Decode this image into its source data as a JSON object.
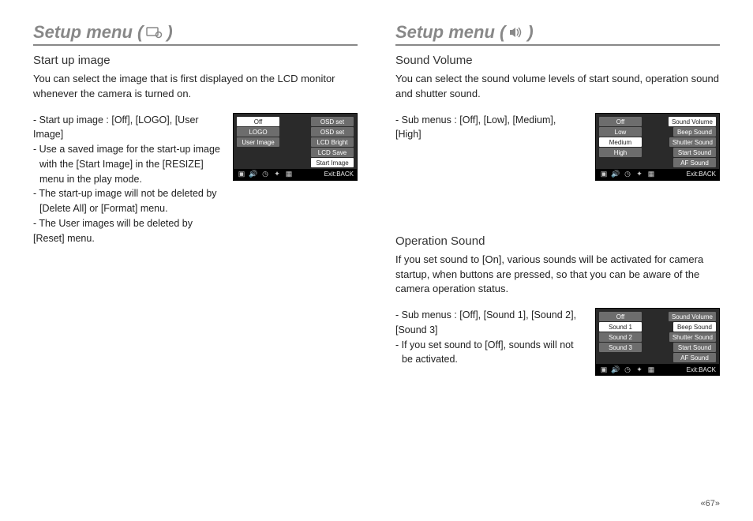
{
  "page_number": "«67»",
  "left": {
    "title_pre": "Setup menu (",
    "title_post": ")",
    "sections": [
      {
        "heading": "Start up image",
        "desc": "You can select the image that is first displayed on the LCD monitor whenever the camera is turned on.",
        "bullets": [
          "- Start up image : [Off], [LOGO], [User Image]",
          "- Use a saved image for the start-up image with the [Start Image] in the [RESIZE] menu in the play mode.",
          "- The start-up image will not be deleted by [Delete All] or [Format] menu.",
          "- The User images will be deleted by [Reset] menu."
        ],
        "lcd": {
          "left_items": [
            "Off",
            "LOGO",
            "User Image",
            "",
            ""
          ],
          "left_selected": 0,
          "right_items": [
            "OSD set",
            "OSD set",
            "LCD Bright",
            "LCD Save",
            "Start Image"
          ],
          "right_selected": 4,
          "right_arrow_on_selected": true,
          "exit": "Exit:BACK"
        }
      }
    ]
  },
  "right": {
    "title_pre": "Setup menu (",
    "title_post": ")",
    "sections": [
      {
        "heading": "Sound Volume",
        "desc": "You can select the sound volume levels of start sound, operation sound and shutter sound.",
        "bullets": [
          "- Sub menus : [Off], [Low], [Medium], [High]"
        ],
        "lcd": {
          "left_items": [
            "Off",
            "Low",
            "Medium",
            "High",
            ""
          ],
          "left_selected": 2,
          "right_items": [
            "Sound Volume",
            "Beep Sound",
            "Shutter Sound",
            "Start Sound",
            "AF Sound"
          ],
          "right_selected": 0,
          "right_arrow_on_selected": true,
          "exit": "Exit:BACK"
        }
      },
      {
        "heading": "Operation Sound",
        "desc": "If you set sound to [On], various sounds will be activated for camera startup, when buttons are pressed, so that you can be aware of the camera operation status.",
        "bullets": [
          "- Sub menus : [Off], [Sound 1], [Sound 2], [Sound 3]",
          "- If you set sound to [Off], sounds will not be activated."
        ],
        "lcd": {
          "left_items": [
            "Off",
            "Sound 1",
            "Sound 2",
            "Sound 3",
            ""
          ],
          "left_selected": 1,
          "right_items": [
            "Sound Volume",
            "Beep Sound",
            "Shutter Sound",
            "Start Sound",
            "AF Sound"
          ],
          "right_selected": 1,
          "right_arrow_on_selected": true,
          "exit": "Exit:BACK"
        }
      }
    ]
  },
  "lcd_icons": [
    "▣",
    "🔊",
    "◷",
    "✦",
    "▦"
  ]
}
